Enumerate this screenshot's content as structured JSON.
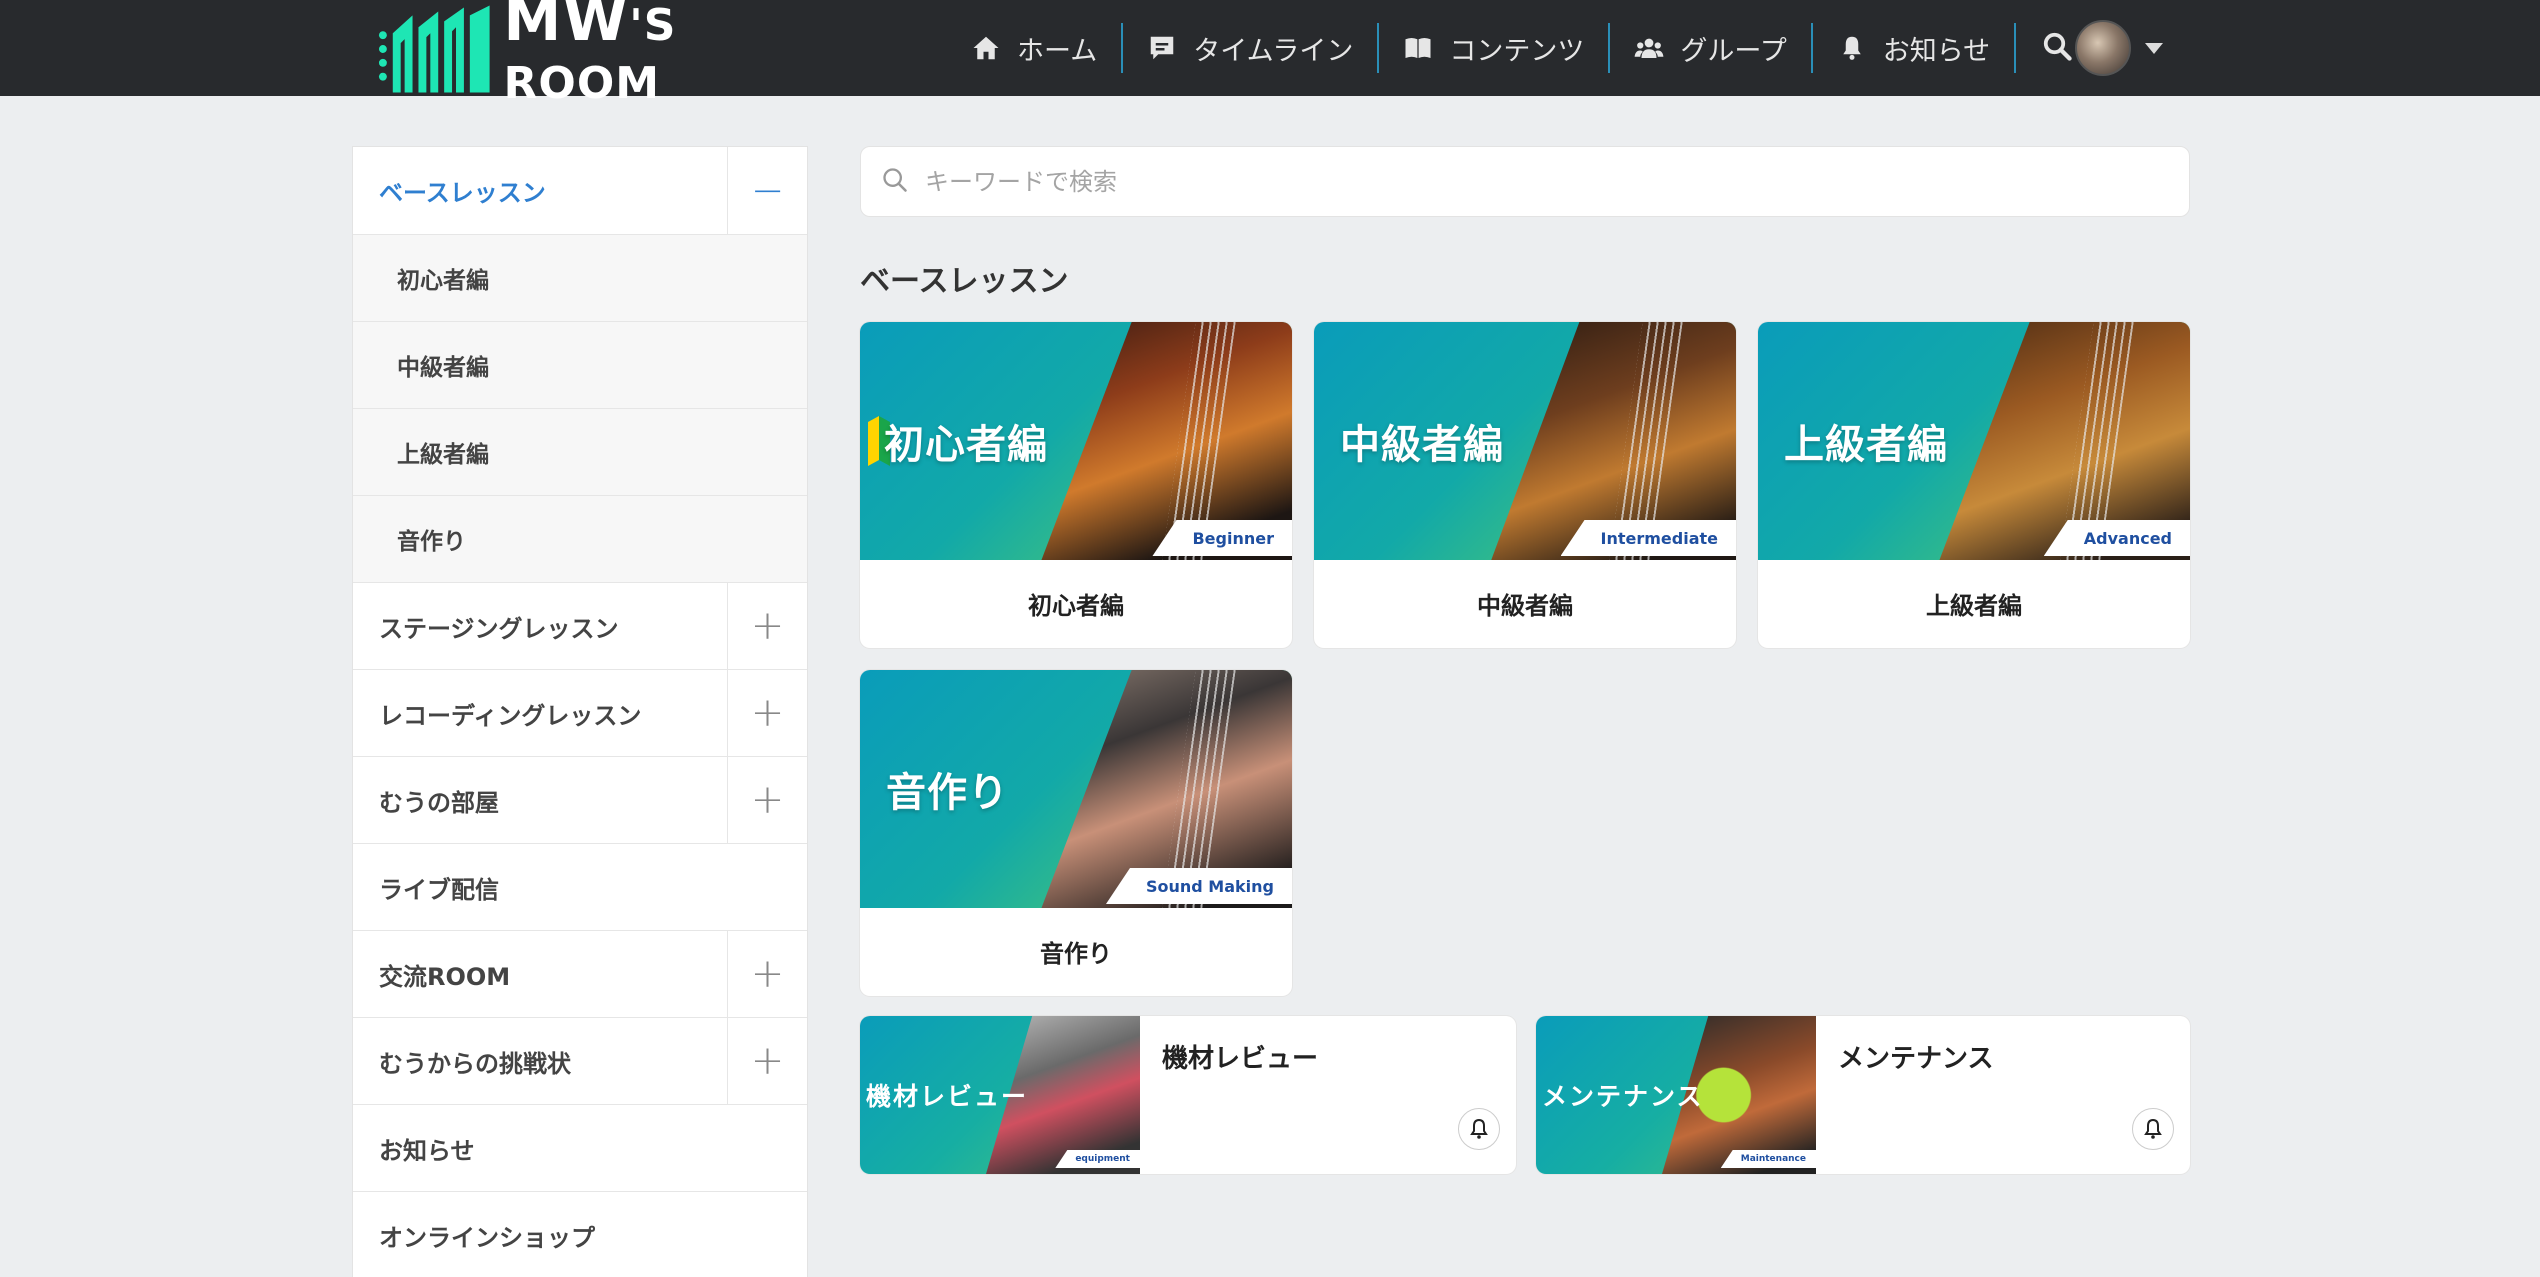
{
  "brand": {
    "logo_main": "MW",
    "logo_suffix": "'S ROOM"
  },
  "nav": {
    "items": [
      {
        "label": "ホーム",
        "icon": "home-icon"
      },
      {
        "label": "タイムライン",
        "icon": "comment-icon"
      },
      {
        "label": "コンテンツ",
        "icon": "book-icon"
      },
      {
        "label": "グループ",
        "icon": "users-icon"
      },
      {
        "label": "お知らせ",
        "icon": "bell-icon"
      }
    ]
  },
  "sidebar": {
    "items": [
      {
        "label": "ベースレッスン",
        "toggle": "−"
      },
      {
        "label": "初心者編"
      },
      {
        "label": "中級者編"
      },
      {
        "label": "上級者編"
      },
      {
        "label": "音作り"
      },
      {
        "label": "ステージングレッスン",
        "toggle": "+"
      },
      {
        "label": "レコーディングレッスン",
        "toggle": "+"
      },
      {
        "label": "むうの部屋",
        "toggle": "+"
      },
      {
        "label": "ライブ配信"
      },
      {
        "label": "交流ROOM",
        "toggle": "+"
      },
      {
        "label": "むうからの挑戦状",
        "toggle": "+"
      },
      {
        "label": "お知らせ"
      },
      {
        "label": "オンラインショップ"
      }
    ]
  },
  "search": {
    "placeholder": "キーワードで検索"
  },
  "section": {
    "title": "ベースレッスン"
  },
  "cards": [
    {
      "thumb_text": "初心者編",
      "tag": "Beginner",
      "caption": "初心者編"
    },
    {
      "thumb_text": "中級者編",
      "tag": "Intermediate",
      "caption": "中級者編"
    },
    {
      "thumb_text": "上級者編",
      "tag": "Advanced",
      "caption": "上級者編"
    },
    {
      "thumb_text": "音作り",
      "tag": "Sound Making",
      "caption": "音作り"
    }
  ],
  "wide_cards": [
    {
      "thumb_text": "機材レビュー",
      "tag": "equipment",
      "title": "機材レビュー"
    },
    {
      "thumb_text": "メンテナンス",
      "tag": "Maintenance",
      "title": "メンテナンス"
    }
  ],
  "colors": {
    "nav_bg": "#282a2d",
    "accent_blue": "#2f7fd0",
    "logo_green": "#1ee6b4",
    "page_bg": "#eceef0"
  }
}
